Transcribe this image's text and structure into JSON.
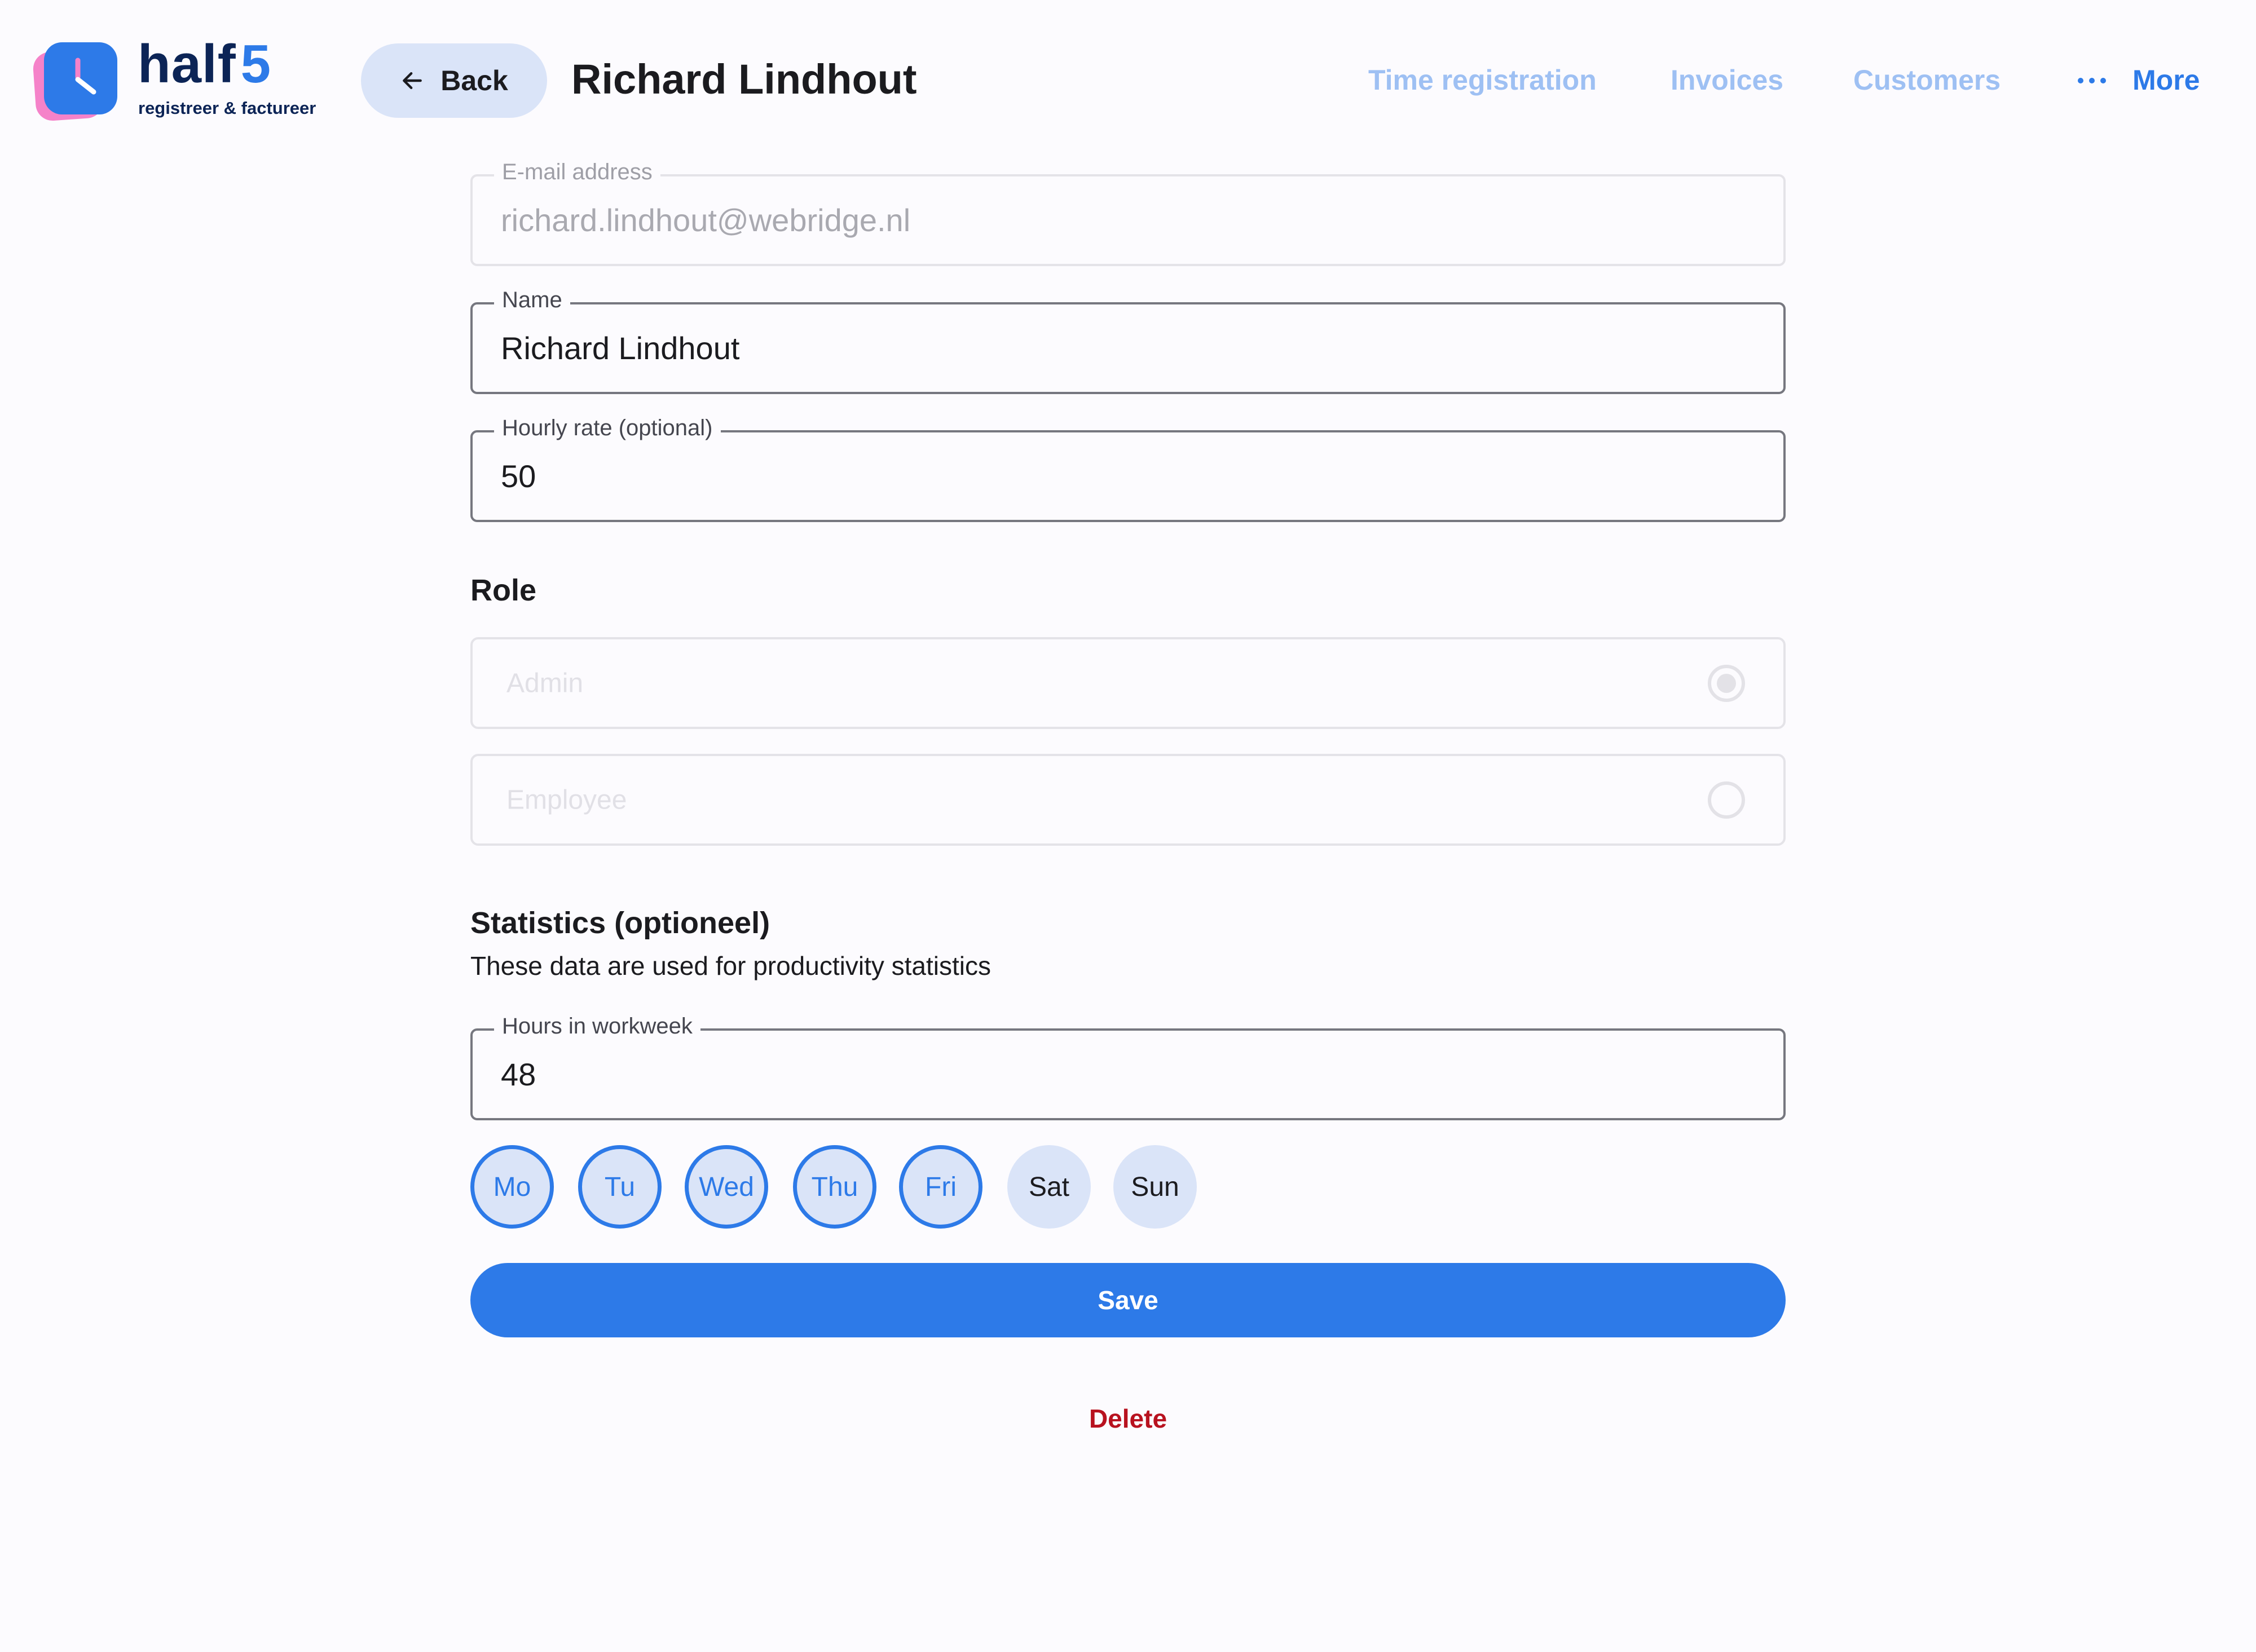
{
  "brand": {
    "name_part1": "half",
    "name_part2": "5",
    "tagline": "registreer & factureer",
    "colors": {
      "primary": "#2d7ae8",
      "navy": "#0c2456",
      "pink": "#f582c9"
    }
  },
  "header": {
    "back_label": "Back",
    "title": "Richard Lindhout"
  },
  "nav": {
    "items": [
      {
        "label": "Time registration"
      },
      {
        "label": "Invoices"
      },
      {
        "label": "Customers"
      }
    ],
    "more_label": "More"
  },
  "form": {
    "email": {
      "label": "E-mail address",
      "value": "richard.lindhout@webridge.nl",
      "disabled": true
    },
    "name": {
      "label": "Name",
      "value": "Richard Lindhout"
    },
    "hourly_rate": {
      "label": "Hourly rate (optional)",
      "value": "50"
    },
    "role": {
      "heading": "Role",
      "options": [
        {
          "label": "Admin",
          "selected": true,
          "disabled": true
        },
        {
          "label": "Employee",
          "selected": false,
          "disabled": true
        }
      ]
    },
    "statistics": {
      "heading": "Statistics (optioneel)",
      "subtitle": "These data are used for productivity statistics",
      "hours": {
        "label": "Hours in workweek",
        "value": "48"
      },
      "days": [
        {
          "label": "Mo",
          "selected": true
        },
        {
          "label": "Tu",
          "selected": true
        },
        {
          "label": "Wed",
          "selected": true
        },
        {
          "label": "Thu",
          "selected": true
        },
        {
          "label": "Fri",
          "selected": true
        },
        {
          "label": "Sat",
          "selected": false
        },
        {
          "label": "Sun",
          "selected": false
        }
      ]
    },
    "save_label": "Save",
    "delete_label": "Delete"
  }
}
